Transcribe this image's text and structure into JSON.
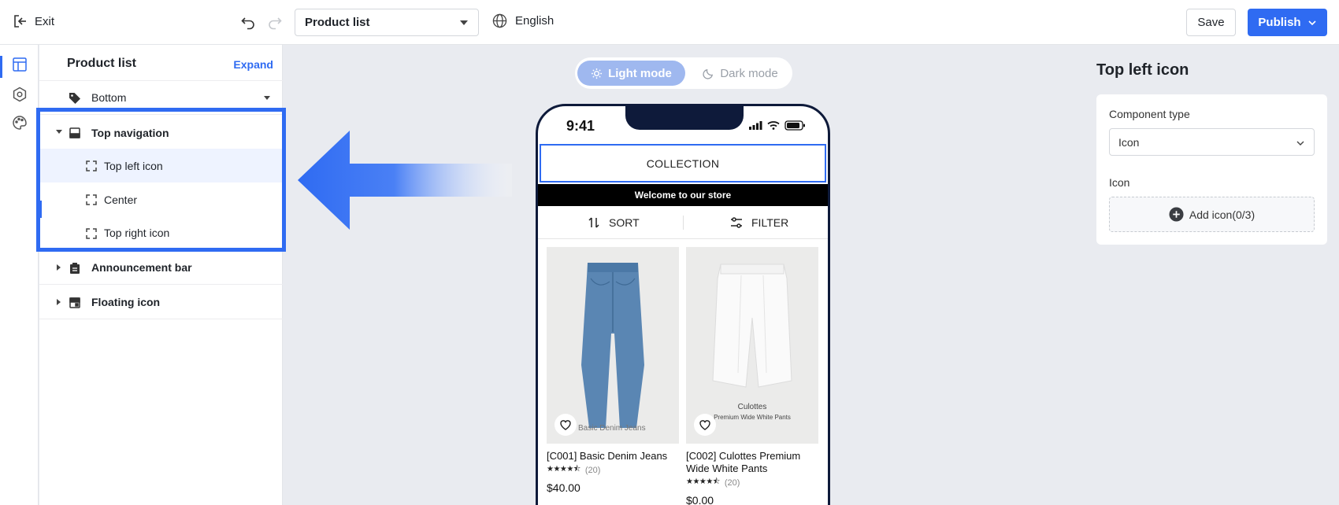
{
  "toolbar": {
    "exit_label": "Exit",
    "page_select_value": "Product list",
    "language": "English",
    "save_label": "Save",
    "publish_label": "Publish"
  },
  "rail": {
    "items": [
      "layout-icon",
      "settings-icon",
      "palette-icon"
    ]
  },
  "tree": {
    "title": "Product list",
    "expand_label": "Expand",
    "rows": {
      "bottom": "Bottom",
      "top_navigation": "Top navigation",
      "top_left_icon": "Top left icon",
      "center": "Center",
      "top_right_icon": "Top right icon",
      "announcement_bar": "Announcement bar",
      "floating_icon": "Floating icon"
    }
  },
  "preview": {
    "mode_light": "Light mode",
    "mode_dark": "Dark mode",
    "time": "9:41",
    "header_title": "COLLECTION",
    "announcement": "Welcome to our store",
    "sort_label": "SORT",
    "filter_label": "FILTER",
    "products": [
      {
        "name": "[C001] Basic Denim Jeans",
        "image_caption": "Basic Denim Jeans",
        "rating": 4.5,
        "reviews": "(20)",
        "price": "$40.00"
      },
      {
        "name": "[C002] Culottes Premium Wide White Pants",
        "image_caption": "Culottes",
        "image_subcaption": "Premium Wide White Pants",
        "rating": 4.5,
        "reviews": "(20)",
        "price": "$0.00"
      }
    ]
  },
  "right_panel": {
    "title": "Top left icon",
    "component_type_label": "Component type",
    "component_type_value": "Icon",
    "icon_label": "Icon",
    "add_icon_label": "Add icon(0/3)"
  },
  "colors": {
    "accent": "#2f6bf2",
    "canvas_bg": "#e9ebf0",
    "phone_frame": "#0e1a3a"
  }
}
